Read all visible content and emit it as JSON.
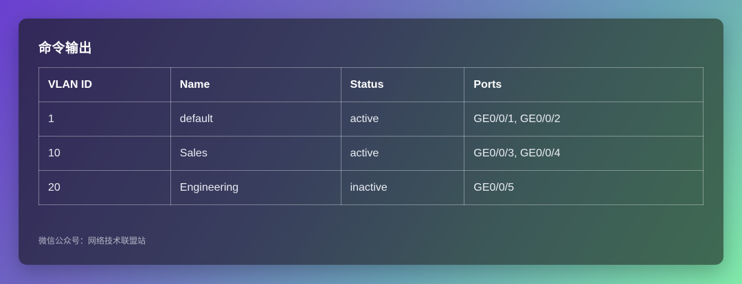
{
  "title": "命令输出",
  "table": {
    "headers": [
      "VLAN ID",
      "Name",
      "Status",
      "Ports"
    ],
    "rows": [
      [
        "1",
        "default",
        "active",
        "GE0/0/1, GE0/0/2"
      ],
      [
        "10",
        "Sales",
        "active",
        "GE0/0/3, GE0/0/4"
      ],
      [
        "20",
        "Engineering",
        "inactive",
        "GE0/0/5"
      ]
    ]
  },
  "footer": "微信公众号：网络技术联盟站",
  "colors": {
    "card_bg_start": "#33285a",
    "card_bg_end": "#3f6a52",
    "text": "#e9ecf2"
  }
}
